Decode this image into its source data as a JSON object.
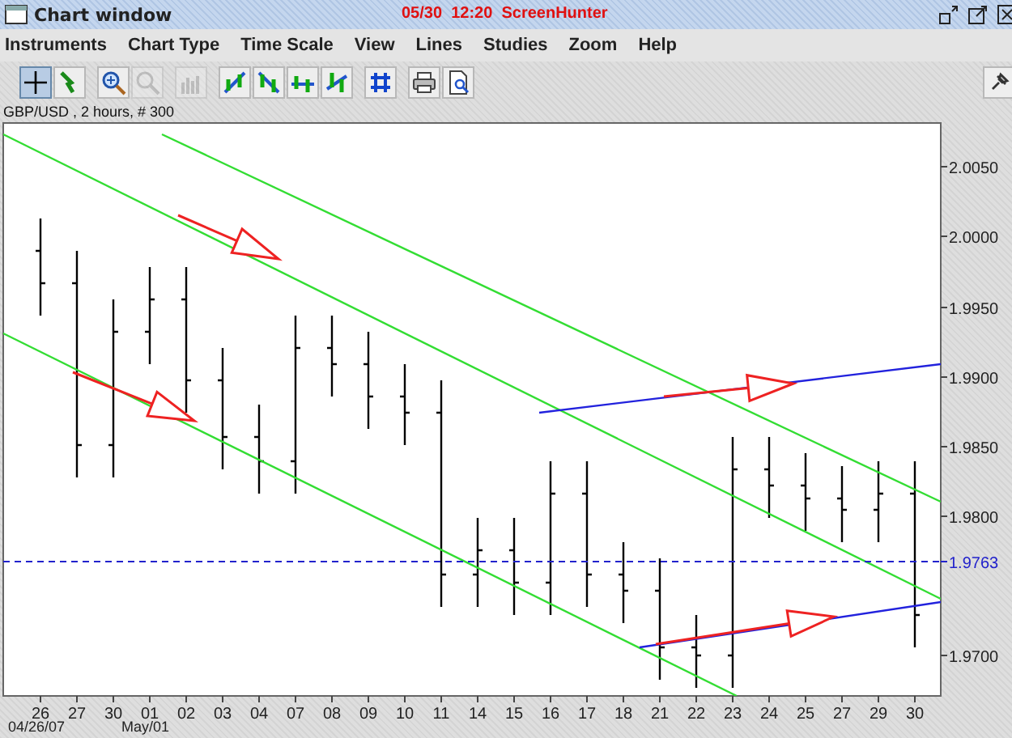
{
  "window": {
    "title": "Chart window",
    "overlay_text": "05/30  12:20  ScreenHunter",
    "buttons": [
      {
        "kind": "restore"
      },
      {
        "kind": "maximize"
      },
      {
        "kind": "close"
      }
    ]
  },
  "menu": [
    "Instruments",
    "Chart Type",
    "Time Scale",
    "View",
    "Lines",
    "Studies",
    "Zoom",
    "Help"
  ],
  "toolbar": [
    [
      {
        "kind": "crosshair",
        "selected": true,
        "disabled": false
      },
      {
        "kind": "drag",
        "selected": false,
        "disabled": false
      }
    ],
    [
      {
        "kind": "zoom-in",
        "selected": false,
        "disabled": false
      },
      {
        "kind": "zoom-out",
        "selected": false,
        "disabled": true
      }
    ],
    [
      {
        "kind": "histogram",
        "selected": false,
        "disabled": true
      }
    ],
    [
      {
        "kind": "trend-up",
        "selected": false,
        "disabled": false
      },
      {
        "kind": "trend-down",
        "selected": false,
        "disabled": false
      },
      {
        "kind": "trend-flat",
        "selected": false,
        "disabled": false
      },
      {
        "kind": "trend-cross",
        "selected": false,
        "disabled": false
      }
    ],
    [
      {
        "kind": "grid",
        "selected": false,
        "disabled": false
      }
    ],
    [
      {
        "kind": "print",
        "selected": false,
        "disabled": false
      },
      {
        "kind": "preview",
        "selected": false,
        "disabled": false
      }
    ]
  ],
  "pin_button": {
    "kind": "pin"
  },
  "caption": "GBP/USD , 2 hours, # 300",
  "chart": {
    "x_axis_labels": [
      "26",
      "27",
      "30",
      "01",
      "02",
      "03",
      "04",
      "07",
      "08",
      "09",
      "10",
      "11",
      "14",
      "15",
      "16",
      "17",
      "18",
      "21",
      "22",
      "23",
      "24",
      "25",
      "27",
      "29",
      "30"
    ],
    "y_axis_labels": [
      "2.0050",
      "2.0000",
      "1.9950",
      "1.9900",
      "1.9850",
      "1.9800",
      "1.9700"
    ],
    "level_label": "1.9763",
    "date_labels": [
      "04/26/07",
      "May/01"
    ]
  }
}
